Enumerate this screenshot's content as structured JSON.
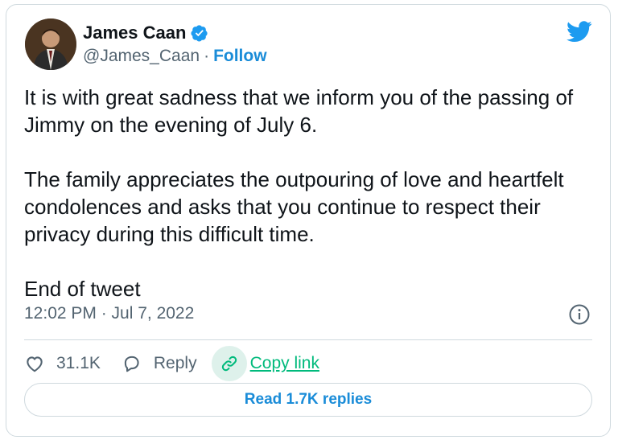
{
  "author": {
    "name": "James Caan",
    "handle": "@James_Caan",
    "separator": "·",
    "follow_label": "Follow"
  },
  "tweet": {
    "paragraphs": [
      "It is with great sadness that we inform you of the passing of Jimmy on the evening of July 6.",
      "The family appreciates the outpouring of love and heartfelt condolences and asks that you continue to respect their privacy during this difficult time.",
      "End of tweet"
    ],
    "timestamp": "12:02 PM · Jul 7, 2022"
  },
  "actions": {
    "like_count": "31.1K",
    "reply_label": "Reply",
    "copy_link_label": "Copy link"
  },
  "replies_button": "Read 1.7K replies",
  "colors": {
    "accent": "#1a8cd8",
    "twitter_blue": "#1d9bf0",
    "copy_green": "#00ba7c",
    "text_muted": "#536471",
    "border": "#cfd9de"
  },
  "icons": [
    "verified-badge-icon",
    "twitter-bird-icon",
    "info-icon",
    "heart-icon",
    "reply-bubble-icon",
    "link-icon"
  ]
}
